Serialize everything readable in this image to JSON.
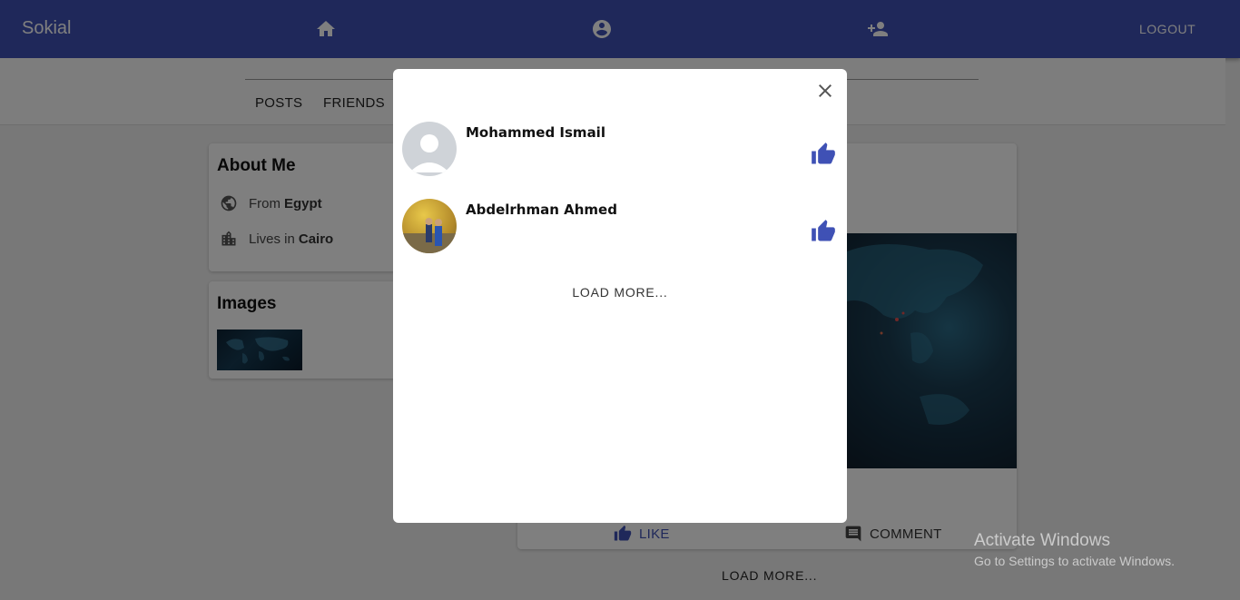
{
  "appbar": {
    "brand": "Sokial",
    "logout_label": "LOGOUT",
    "icons": [
      "home-icon",
      "account-circle-icon",
      "person-add-icon"
    ],
    "color": "#3f51b5"
  },
  "tabs": [
    "POSTS",
    "FRIENDS"
  ],
  "about": {
    "title": "About Me",
    "from_prefix": "From",
    "from_value": "Egypt",
    "lives_prefix": "Lives in",
    "lives_value": "Cairo"
  },
  "images": {
    "title": "Images"
  },
  "post": {
    "like_label": "LIKE",
    "comment_label": "COMMENT",
    "load_more": "LOAD MORE..."
  },
  "modal": {
    "likers": [
      {
        "name": "Mohammed Ismail",
        "avatar": "default-avatar"
      },
      {
        "name": "Abdelrhman Ahmed",
        "avatar": "photo-avatar"
      }
    ],
    "load_more": "LOAD MORE...",
    "accent": "#3f51b5"
  },
  "watermark": {
    "title": "Activate Windows",
    "subtitle": "Go to Settings to activate Windows."
  }
}
